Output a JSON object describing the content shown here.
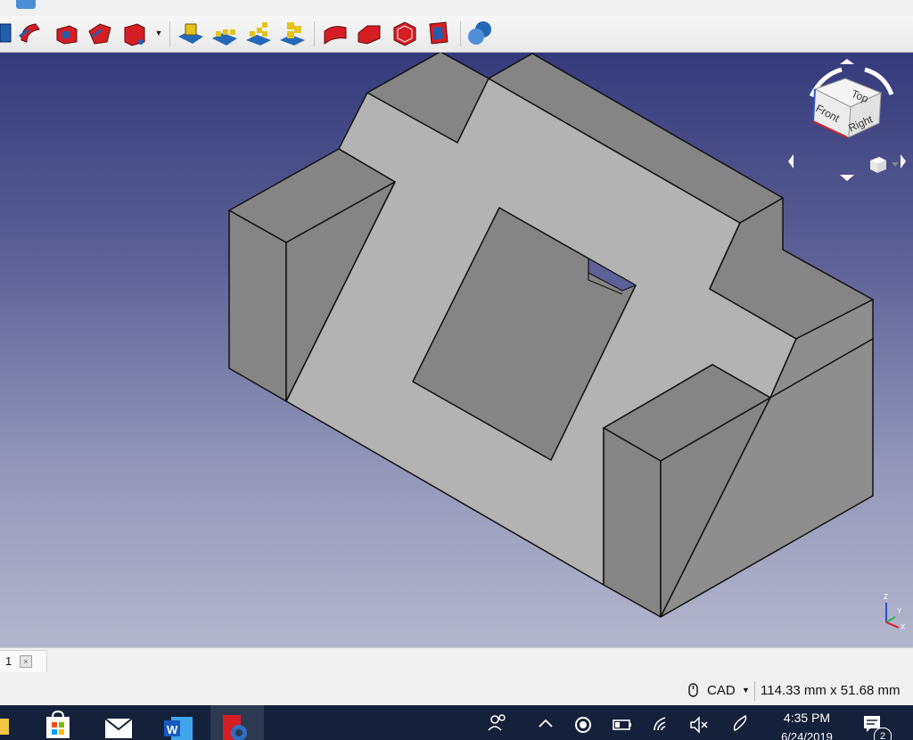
{
  "toolbar": {
    "buttons": [
      "part-tool-1",
      "part-tool-2",
      "part-tool-3",
      "part-tool-4",
      "part-tool-5",
      "lattice-tool-1",
      "lattice-tool-2",
      "lattice-tool-3",
      "lattice-tool-4",
      "solid-tool-1",
      "solid-tool-2",
      "solid-tool-3",
      "solid-tool-4",
      "boolean-tool"
    ]
  },
  "navcube": {
    "top": "Top",
    "front": "Front",
    "right": "Right"
  },
  "axis": {
    "z": "Z",
    "y": "Y",
    "x": "X"
  },
  "tabs": [
    {
      "label": "1",
      "close": "×"
    }
  ],
  "status": {
    "nav_style": "CAD",
    "dimensions": "114.33 mm x 51.68 mm"
  },
  "taskbar": {
    "apps": [
      "file-explorer-icon",
      "store-icon",
      "mail-icon",
      "word-icon",
      "freecad-icon"
    ],
    "time": "4:35 PM",
    "date": "6/24/2019",
    "notification_count": "2"
  },
  "colors": {
    "face_light": "#b3b3b3",
    "face_dark": "#858585",
    "face_mid": "#999999",
    "edge": "#111111",
    "accent_red": "#d7191c"
  }
}
